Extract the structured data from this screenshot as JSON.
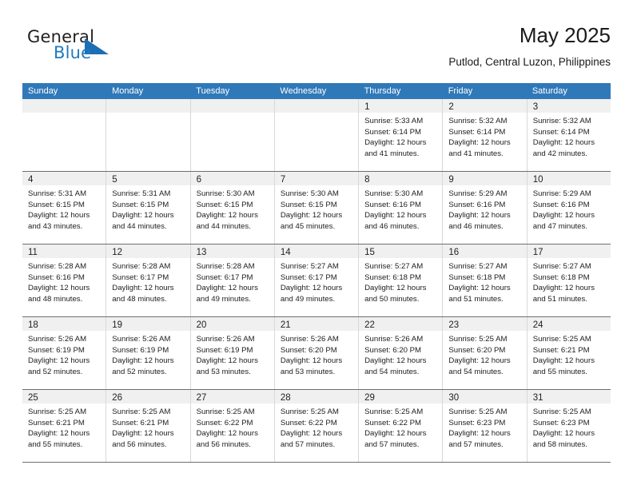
{
  "brand": {
    "name_top": "General",
    "name_bottom": "Blue",
    "accent_color": "#1b6fb4"
  },
  "header": {
    "title": "May 2025",
    "subtitle": "Putlod, Central Luzon, Philippines"
  },
  "theme": {
    "header_bar_color": "#3079b9",
    "day_strip_color": "#f0f0f0",
    "row_divider_color": "#6f6f6f"
  },
  "weekdays": [
    "Sunday",
    "Monday",
    "Tuesday",
    "Wednesday",
    "Thursday",
    "Friday",
    "Saturday"
  ],
  "labels": {
    "sunrise_prefix": "Sunrise:",
    "sunset_prefix": "Sunset:",
    "daylight_prefix": "Daylight:"
  },
  "weeks": [
    [
      {
        "empty": true
      },
      {
        "empty": true
      },
      {
        "empty": true
      },
      {
        "empty": true
      },
      {
        "day": "1",
        "sunrise": "Sunrise: 5:33 AM",
        "sunset": "Sunset: 6:14 PM",
        "daylight_1": "Daylight: 12 hours",
        "daylight_2": "and 41 minutes."
      },
      {
        "day": "2",
        "sunrise": "Sunrise: 5:32 AM",
        "sunset": "Sunset: 6:14 PM",
        "daylight_1": "Daylight: 12 hours",
        "daylight_2": "and 41 minutes."
      },
      {
        "day": "3",
        "sunrise": "Sunrise: 5:32 AM",
        "sunset": "Sunset: 6:14 PM",
        "daylight_1": "Daylight: 12 hours",
        "daylight_2": "and 42 minutes."
      }
    ],
    [
      {
        "day": "4",
        "sunrise": "Sunrise: 5:31 AM",
        "sunset": "Sunset: 6:15 PM",
        "daylight_1": "Daylight: 12 hours",
        "daylight_2": "and 43 minutes."
      },
      {
        "day": "5",
        "sunrise": "Sunrise: 5:31 AM",
        "sunset": "Sunset: 6:15 PM",
        "daylight_1": "Daylight: 12 hours",
        "daylight_2": "and 44 minutes."
      },
      {
        "day": "6",
        "sunrise": "Sunrise: 5:30 AM",
        "sunset": "Sunset: 6:15 PM",
        "daylight_1": "Daylight: 12 hours",
        "daylight_2": "and 44 minutes."
      },
      {
        "day": "7",
        "sunrise": "Sunrise: 5:30 AM",
        "sunset": "Sunset: 6:15 PM",
        "daylight_1": "Daylight: 12 hours",
        "daylight_2": "and 45 minutes."
      },
      {
        "day": "8",
        "sunrise": "Sunrise: 5:30 AM",
        "sunset": "Sunset: 6:16 PM",
        "daylight_1": "Daylight: 12 hours",
        "daylight_2": "and 46 minutes."
      },
      {
        "day": "9",
        "sunrise": "Sunrise: 5:29 AM",
        "sunset": "Sunset: 6:16 PM",
        "daylight_1": "Daylight: 12 hours",
        "daylight_2": "and 46 minutes."
      },
      {
        "day": "10",
        "sunrise": "Sunrise: 5:29 AM",
        "sunset": "Sunset: 6:16 PM",
        "daylight_1": "Daylight: 12 hours",
        "daylight_2": "and 47 minutes."
      }
    ],
    [
      {
        "day": "11",
        "sunrise": "Sunrise: 5:28 AM",
        "sunset": "Sunset: 6:16 PM",
        "daylight_1": "Daylight: 12 hours",
        "daylight_2": "and 48 minutes."
      },
      {
        "day": "12",
        "sunrise": "Sunrise: 5:28 AM",
        "sunset": "Sunset: 6:17 PM",
        "daylight_1": "Daylight: 12 hours",
        "daylight_2": "and 48 minutes."
      },
      {
        "day": "13",
        "sunrise": "Sunrise: 5:28 AM",
        "sunset": "Sunset: 6:17 PM",
        "daylight_1": "Daylight: 12 hours",
        "daylight_2": "and 49 minutes."
      },
      {
        "day": "14",
        "sunrise": "Sunrise: 5:27 AM",
        "sunset": "Sunset: 6:17 PM",
        "daylight_1": "Daylight: 12 hours",
        "daylight_2": "and 49 minutes."
      },
      {
        "day": "15",
        "sunrise": "Sunrise: 5:27 AM",
        "sunset": "Sunset: 6:18 PM",
        "daylight_1": "Daylight: 12 hours",
        "daylight_2": "and 50 minutes."
      },
      {
        "day": "16",
        "sunrise": "Sunrise: 5:27 AM",
        "sunset": "Sunset: 6:18 PM",
        "daylight_1": "Daylight: 12 hours",
        "daylight_2": "and 51 minutes."
      },
      {
        "day": "17",
        "sunrise": "Sunrise: 5:27 AM",
        "sunset": "Sunset: 6:18 PM",
        "daylight_1": "Daylight: 12 hours",
        "daylight_2": "and 51 minutes."
      }
    ],
    [
      {
        "day": "18",
        "sunrise": "Sunrise: 5:26 AM",
        "sunset": "Sunset: 6:19 PM",
        "daylight_1": "Daylight: 12 hours",
        "daylight_2": "and 52 minutes."
      },
      {
        "day": "19",
        "sunrise": "Sunrise: 5:26 AM",
        "sunset": "Sunset: 6:19 PM",
        "daylight_1": "Daylight: 12 hours",
        "daylight_2": "and 52 minutes."
      },
      {
        "day": "20",
        "sunrise": "Sunrise: 5:26 AM",
        "sunset": "Sunset: 6:19 PM",
        "daylight_1": "Daylight: 12 hours",
        "daylight_2": "and 53 minutes."
      },
      {
        "day": "21",
        "sunrise": "Sunrise: 5:26 AM",
        "sunset": "Sunset: 6:20 PM",
        "daylight_1": "Daylight: 12 hours",
        "daylight_2": "and 53 minutes."
      },
      {
        "day": "22",
        "sunrise": "Sunrise: 5:26 AM",
        "sunset": "Sunset: 6:20 PM",
        "daylight_1": "Daylight: 12 hours",
        "daylight_2": "and 54 minutes."
      },
      {
        "day": "23",
        "sunrise": "Sunrise: 5:25 AM",
        "sunset": "Sunset: 6:20 PM",
        "daylight_1": "Daylight: 12 hours",
        "daylight_2": "and 54 minutes."
      },
      {
        "day": "24",
        "sunrise": "Sunrise: 5:25 AM",
        "sunset": "Sunset: 6:21 PM",
        "daylight_1": "Daylight: 12 hours",
        "daylight_2": "and 55 minutes."
      }
    ],
    [
      {
        "day": "25",
        "sunrise": "Sunrise: 5:25 AM",
        "sunset": "Sunset: 6:21 PM",
        "daylight_1": "Daylight: 12 hours",
        "daylight_2": "and 55 minutes."
      },
      {
        "day": "26",
        "sunrise": "Sunrise: 5:25 AM",
        "sunset": "Sunset: 6:21 PM",
        "daylight_1": "Daylight: 12 hours",
        "daylight_2": "and 56 minutes."
      },
      {
        "day": "27",
        "sunrise": "Sunrise: 5:25 AM",
        "sunset": "Sunset: 6:22 PM",
        "daylight_1": "Daylight: 12 hours",
        "daylight_2": "and 56 minutes."
      },
      {
        "day": "28",
        "sunrise": "Sunrise: 5:25 AM",
        "sunset": "Sunset: 6:22 PM",
        "daylight_1": "Daylight: 12 hours",
        "daylight_2": "and 57 minutes."
      },
      {
        "day": "29",
        "sunrise": "Sunrise: 5:25 AM",
        "sunset": "Sunset: 6:22 PM",
        "daylight_1": "Daylight: 12 hours",
        "daylight_2": "and 57 minutes."
      },
      {
        "day": "30",
        "sunrise": "Sunrise: 5:25 AM",
        "sunset": "Sunset: 6:23 PM",
        "daylight_1": "Daylight: 12 hours",
        "daylight_2": "and 57 minutes."
      },
      {
        "day": "31",
        "sunrise": "Sunrise: 5:25 AM",
        "sunset": "Sunset: 6:23 PM",
        "daylight_1": "Daylight: 12 hours",
        "daylight_2": "and 58 minutes."
      }
    ]
  ]
}
